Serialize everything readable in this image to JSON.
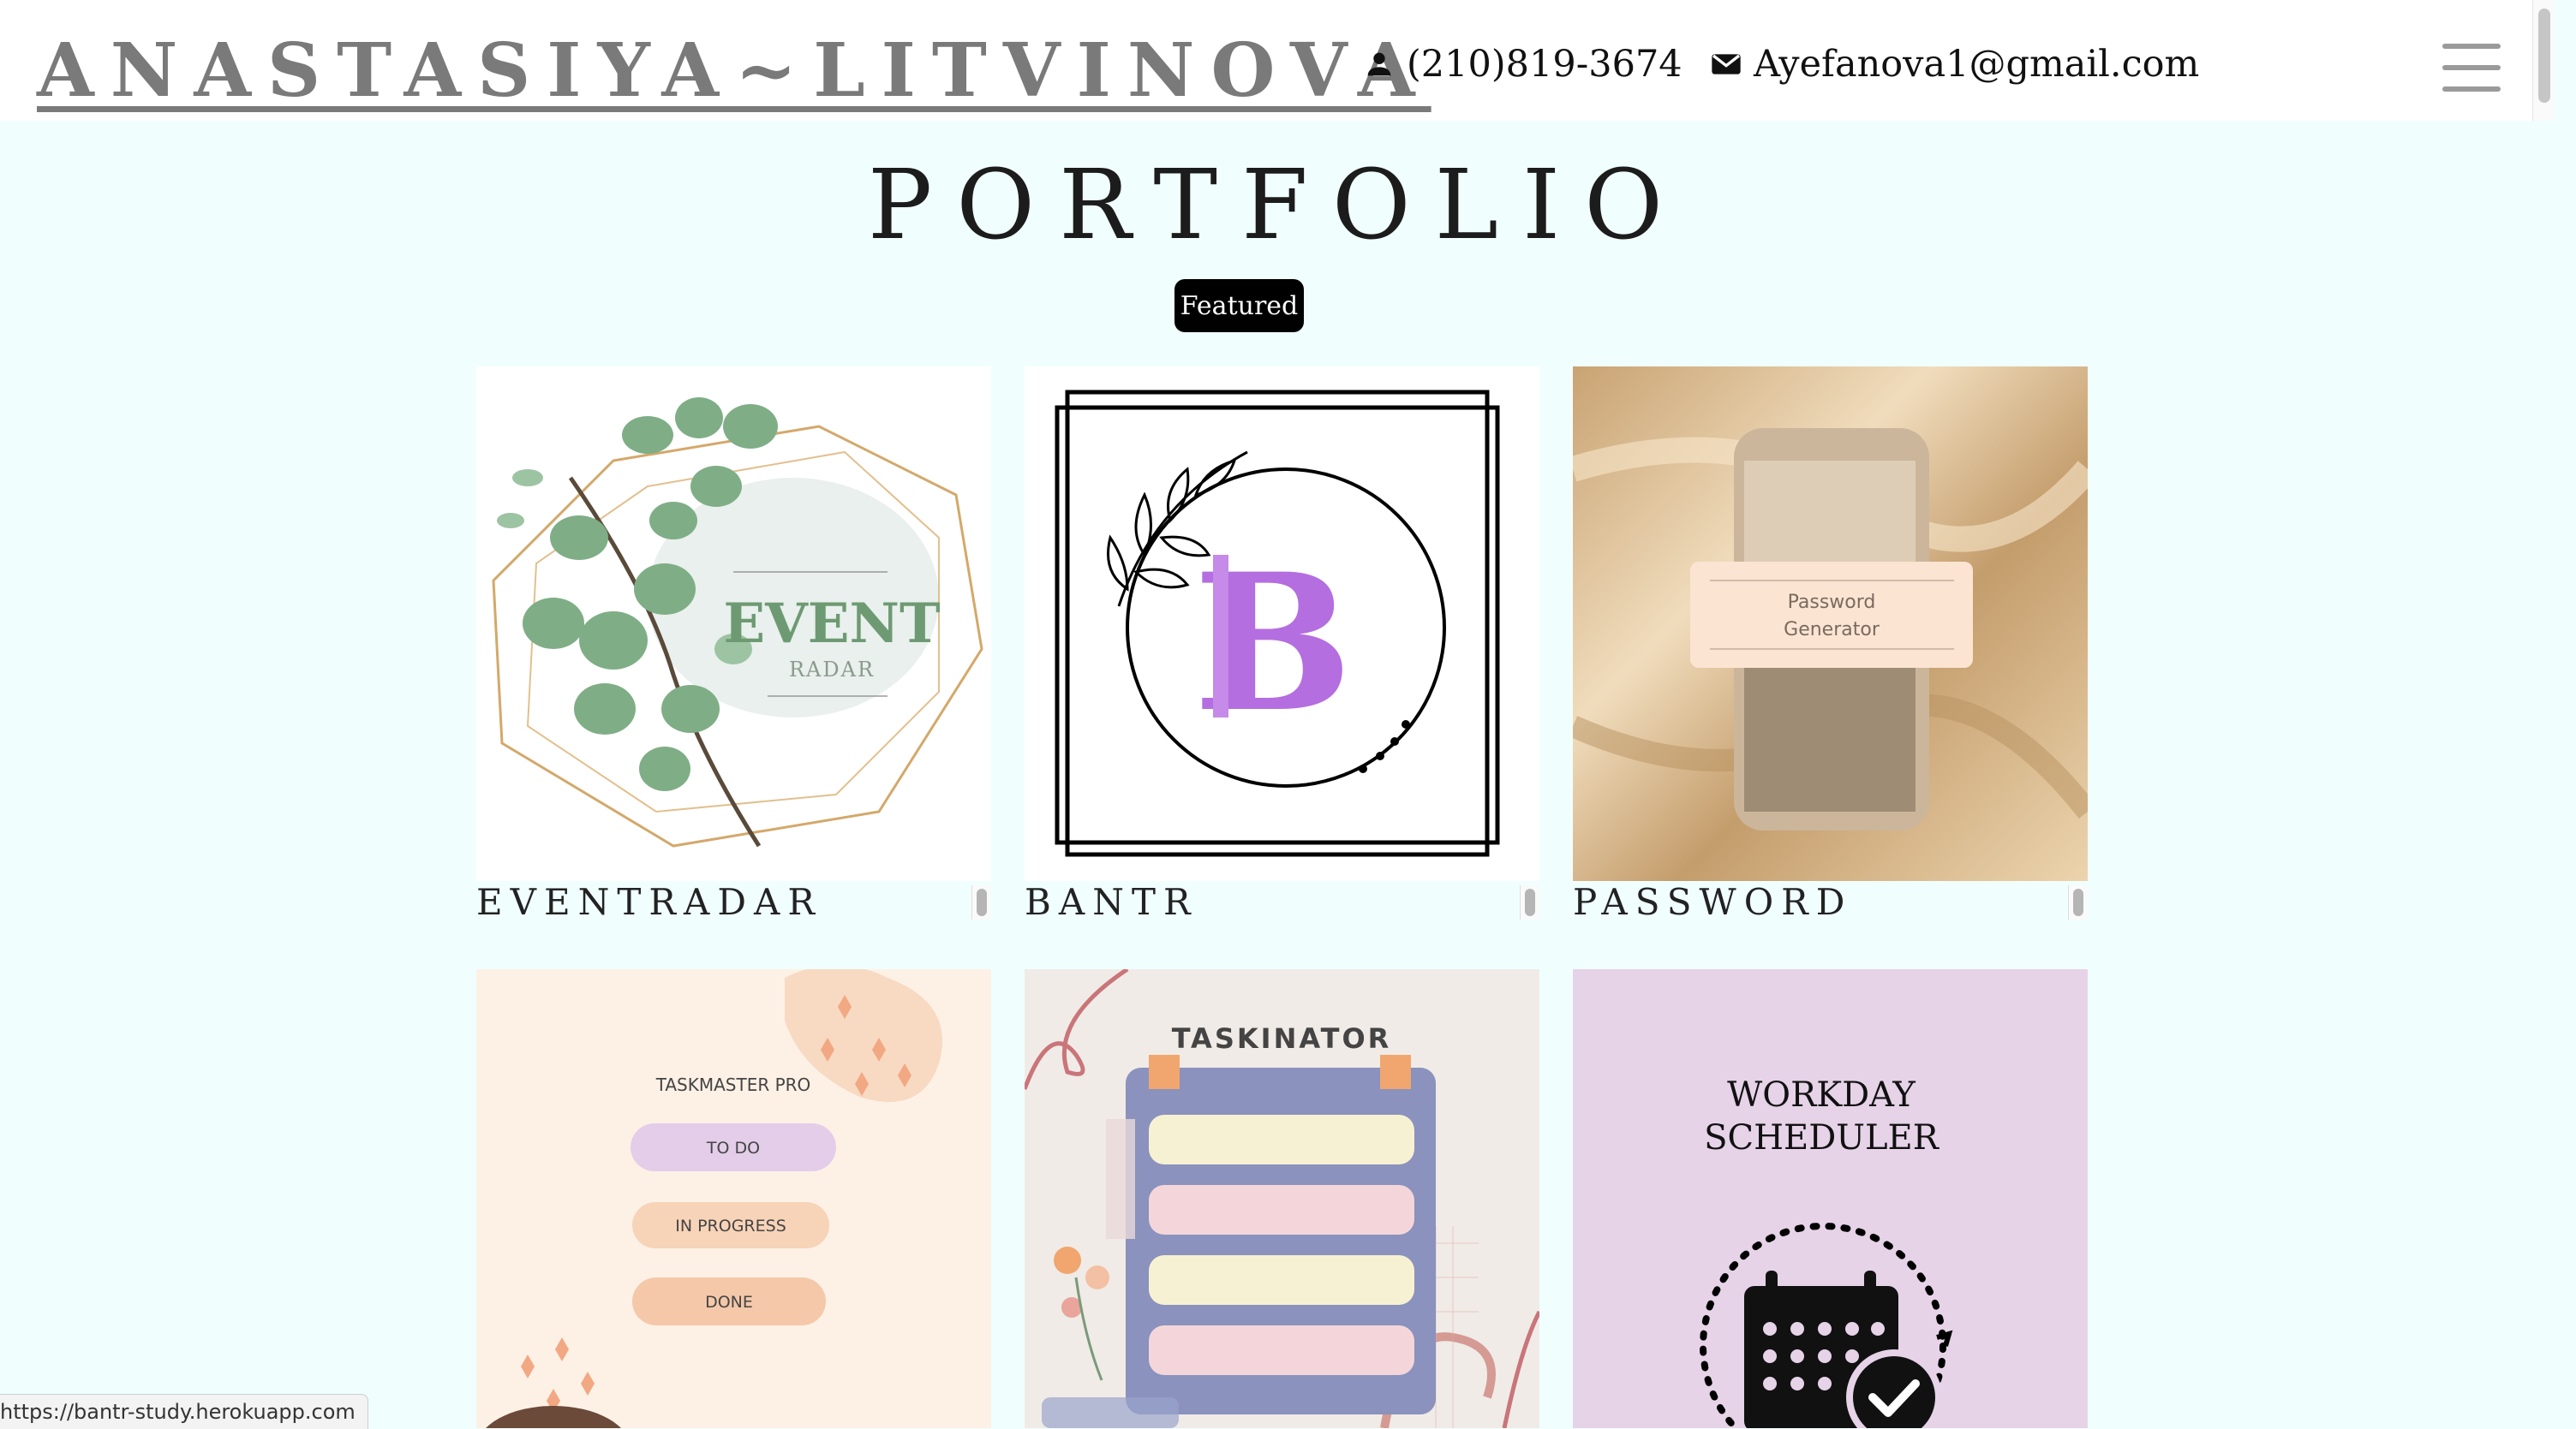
{
  "header": {
    "brand": "ANASTASIYA~LITVINOVA",
    "phone": "(210)819-3674",
    "email": "Ayefanova1@gmail.com",
    "phone_icon": "person-icon",
    "email_icon": "mail-icon",
    "menu_icon": "hamburger-menu-icon"
  },
  "page": {
    "title": "PORTFOLIO",
    "filter_label": "Featured"
  },
  "projects": [
    {
      "caption": "EVENTRADAR",
      "art_title": "EVENT",
      "art_subtitle": "RADAR"
    },
    {
      "caption": "BANTR"
    },
    {
      "caption": "PASSWORD",
      "art_line1": "Password",
      "art_line2": "Generator"
    },
    {
      "art_title": "TASKMASTER PRO",
      "art_items": [
        "TO DO",
        "IN PROGRESS",
        "DONE"
      ]
    },
    {
      "art_title": "TASKINATOR"
    },
    {
      "art_line1": "WORKDAY",
      "art_line2": "SCHEDULER"
    }
  ],
  "status_bar": {
    "url": "https://bantr-study.herokuapp.com"
  },
  "colors": {
    "page_bg": "#f0fffe",
    "header_bg": "#ffffff",
    "brand_gray": "#7a7a7a",
    "featured_bg": "#000000",
    "card_peach": "#fdf1e6",
    "card_lavender": "#e6d3e8",
    "bantr_purple": "#b46ee0"
  }
}
